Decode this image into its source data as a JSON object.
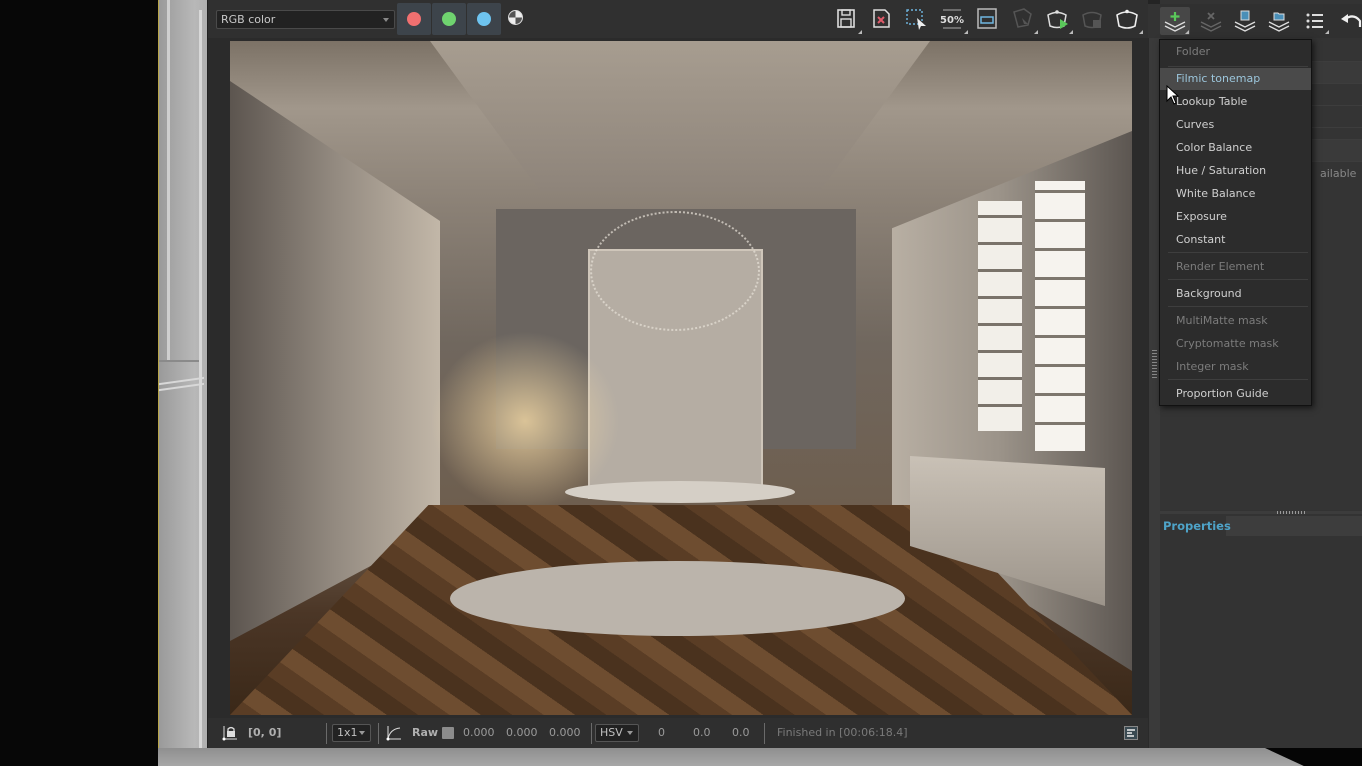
{
  "toolbar": {
    "channel_select": {
      "value": "RGB color"
    },
    "channel_buttons": [
      {
        "name": "red-channel",
        "color": "#f07070"
      },
      {
        "name": "green-channel",
        "color": "#6fd36f"
      },
      {
        "name": "blue-channel",
        "color": "#6ec4f0"
      }
    ],
    "mono_button": "mono-icon",
    "actions": [
      {
        "icon": "save-image-icon"
      },
      {
        "icon": "clear-image-icon"
      },
      {
        "icon": "region-render-icon"
      },
      {
        "icon": "zoom-50-icon",
        "label": "50%"
      },
      {
        "icon": "test-resolution-icon"
      },
      {
        "icon": "track-mouse-icon",
        "disabled": true
      },
      {
        "icon": "render-interactive-icon"
      },
      {
        "icon": "stop-render-icon",
        "disabled": true
      },
      {
        "icon": "render-icon"
      }
    ]
  },
  "layers_toolbar": {
    "actions": [
      {
        "icon": "create-layer-icon",
        "active": true
      },
      {
        "icon": "delete-layer-icon",
        "disabled": true
      },
      {
        "icon": "save-layer-tree-icon"
      },
      {
        "icon": "load-layer-tree-icon"
      },
      {
        "icon": "layer-list-icon"
      },
      {
        "icon": "undo-icon"
      }
    ]
  },
  "layers_panel": {
    "partial_text": "ailable"
  },
  "create_layer_menu": {
    "items": [
      {
        "label": "Folder",
        "disabled": true
      },
      {
        "label": "Filmic tonemap",
        "hover": true
      },
      {
        "label": "Lookup Table"
      },
      {
        "label": "Curves"
      },
      {
        "label": "Color Balance"
      },
      {
        "label": "Hue / Saturation"
      },
      {
        "label": "White Balance"
      },
      {
        "label": "Exposure"
      },
      {
        "label": "Constant"
      },
      {
        "label": "Render Element",
        "disabled": true
      },
      {
        "label": "Background"
      },
      {
        "label": "MultiMatte mask",
        "disabled": true
      },
      {
        "label": "Cryptomatte mask",
        "disabled": true
      },
      {
        "label": "Integer mask",
        "disabled": true
      },
      {
        "label": "Proportion Guide"
      }
    ]
  },
  "properties": {
    "tab_label": "Properties",
    "accent": "#4ea3c8"
  },
  "statusbar": {
    "coordinates": "[0, 0]",
    "sample_size": "1x1",
    "color_mode": "Raw",
    "raw_values": [
      "0.000",
      "0.000",
      "0.000"
    ],
    "color_space": "HSV",
    "hsv_values": [
      "0",
      "0.0",
      "0.0"
    ],
    "status": "Finished in [00:06:18.4]"
  },
  "render": {
    "description": "Rendered interior of a dining room with kitchen counter, chandelier, round table, white chairs and herringbone floor"
  }
}
